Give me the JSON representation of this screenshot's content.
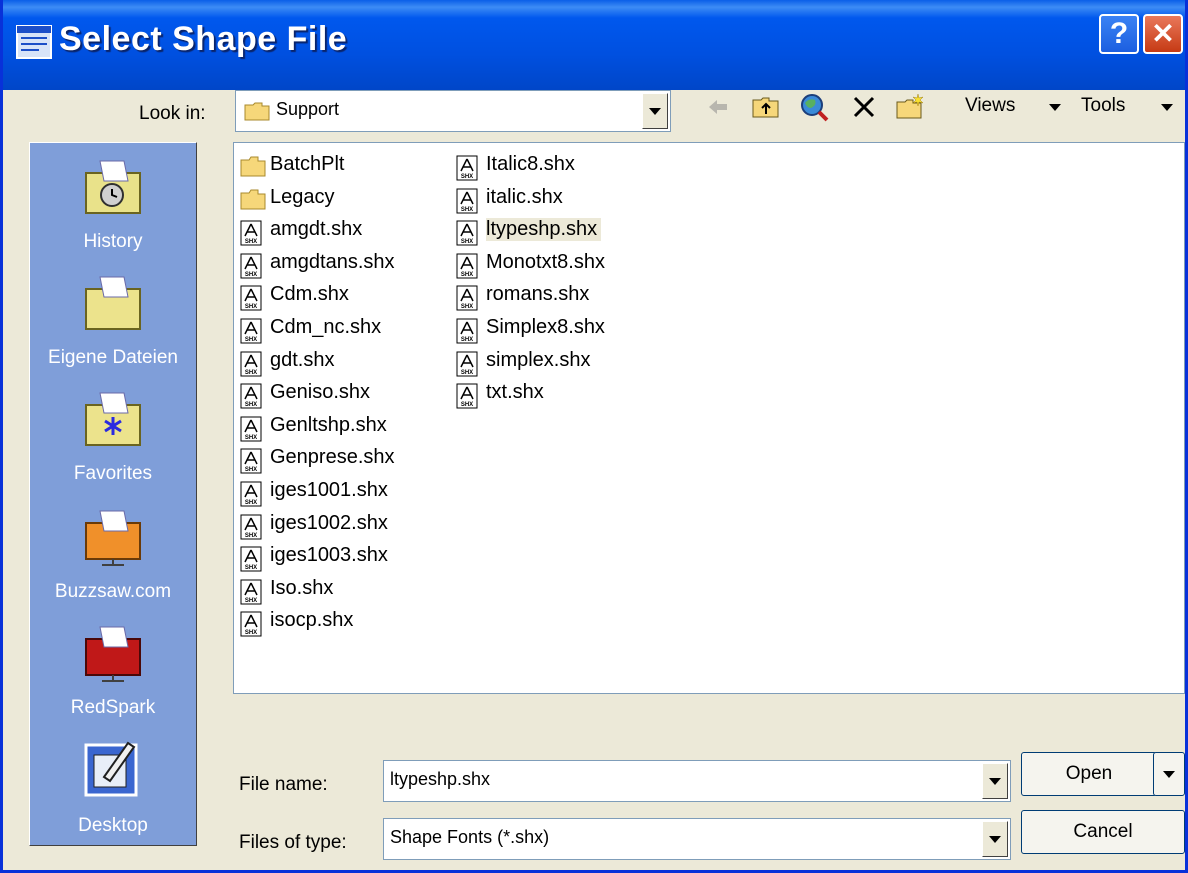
{
  "window": {
    "title": "Select Shape File",
    "help_label": "?",
    "close_label": "✕"
  },
  "toolbar": {
    "look_in_label": "Look in:",
    "look_in_value": "Support",
    "views_label": "Views",
    "tools_label": "Tools"
  },
  "places": [
    {
      "label": "History",
      "icon": "history-folder-icon"
    },
    {
      "label": "Eigene Dateien",
      "icon": "folder-icon"
    },
    {
      "label": "Favorites",
      "icon": "favorites-folder-icon"
    },
    {
      "label": "Buzzsaw.com",
      "icon": "buzzsaw-folder-icon"
    },
    {
      "label": "RedSpark",
      "icon": "redspark-folder-icon"
    },
    {
      "label": "Desktop",
      "icon": "desktop-icon"
    }
  ],
  "files_col1": [
    {
      "name": "BatchPlt",
      "type": "folder"
    },
    {
      "name": "Legacy",
      "type": "folder"
    },
    {
      "name": "amgdt.shx",
      "type": "shx"
    },
    {
      "name": "amgdtans.shx",
      "type": "shx"
    },
    {
      "name": "Cdm.shx",
      "type": "shx"
    },
    {
      "name": "Cdm_nc.shx",
      "type": "shx"
    },
    {
      "name": "gdt.shx",
      "type": "shx"
    },
    {
      "name": "Geniso.shx",
      "type": "shx"
    },
    {
      "name": "Genltshp.shx",
      "type": "shx"
    },
    {
      "name": "Genprese.shx",
      "type": "shx"
    },
    {
      "name": "iges1001.shx",
      "type": "shx"
    },
    {
      "name": "iges1002.shx",
      "type": "shx"
    },
    {
      "name": "iges1003.shx",
      "type": "shx"
    },
    {
      "name": "Iso.shx",
      "type": "shx"
    },
    {
      "name": "isocp.shx",
      "type": "shx"
    }
  ],
  "files_col2": [
    {
      "name": "Italic8.shx",
      "type": "shx"
    },
    {
      "name": "italic.shx",
      "type": "shx"
    },
    {
      "name": "ltypeshp.shx",
      "type": "shx",
      "selected": true
    },
    {
      "name": "Monotxt8.shx",
      "type": "shx"
    },
    {
      "name": "romans.shx",
      "type": "shx"
    },
    {
      "name": "Simplex8.shx",
      "type": "shx"
    },
    {
      "name": "simplex.shx",
      "type": "shx"
    },
    {
      "name": "txt.shx",
      "type": "shx"
    }
  ],
  "footer": {
    "file_name_label": "File name:",
    "file_name_value": "ltypeshp.shx",
    "file_type_label": "Files of type:",
    "file_type_value": "Shape Fonts (*.shx)",
    "open_label": "Open",
    "cancel_label": "Cancel"
  },
  "colors": {
    "titlebar": "#0054e3",
    "places_bg": "#7f9ed9",
    "dialog_bg": "#ece9d8",
    "selected_bg": "#ece9d8"
  }
}
